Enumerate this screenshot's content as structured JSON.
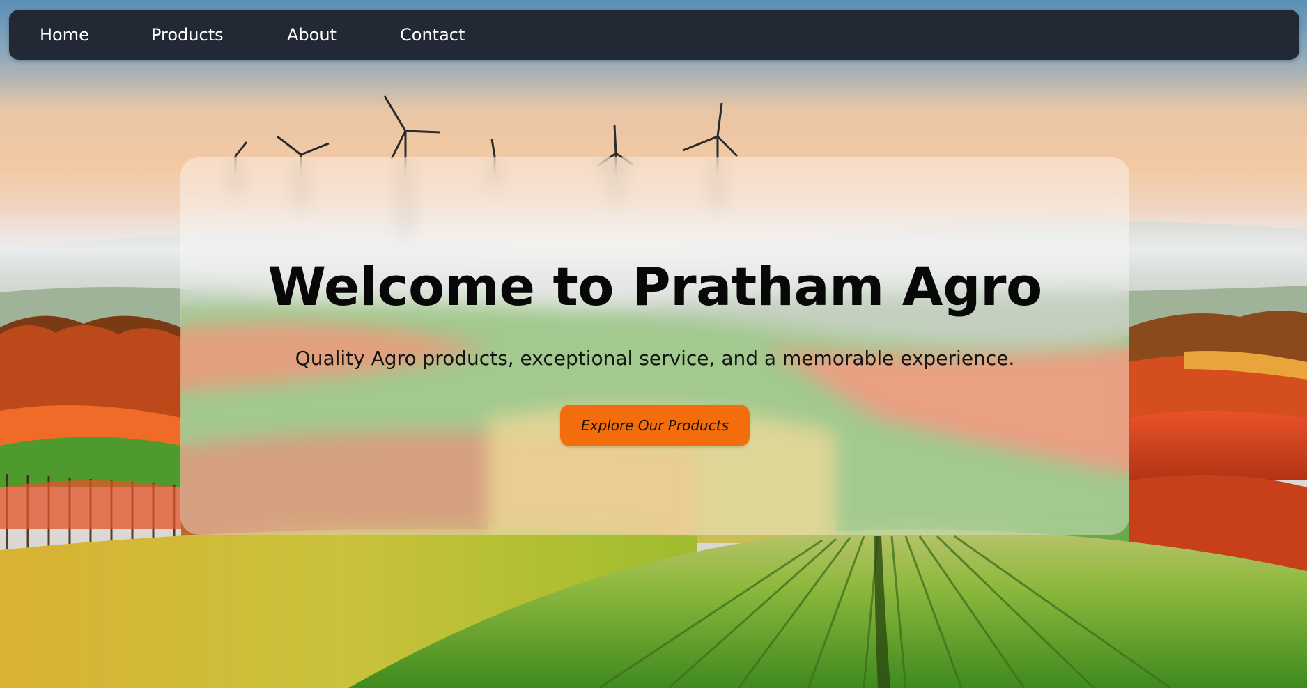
{
  "nav": {
    "items": [
      {
        "label": "Home"
      },
      {
        "label": "Products"
      },
      {
        "label": "About"
      },
      {
        "label": "Contact"
      }
    ]
  },
  "hero": {
    "title": "Welcome to Pratham Agro",
    "subtitle": "Quality Agro products, exceptional service, and a memorable experience.",
    "cta_label": "Explore Our Products"
  },
  "colors": {
    "nav_background": "#222834",
    "cta_background": "#f46d0c",
    "title_text": "#080808"
  },
  "background_image": "farm-landscape-with-wind-turbines"
}
